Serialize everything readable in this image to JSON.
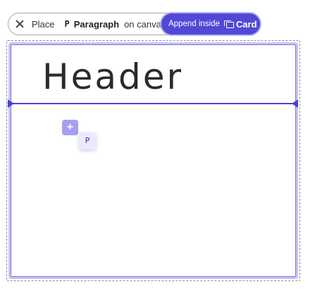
{
  "placement_bar": {
    "close_icon": "close-icon",
    "place_label": "Place",
    "element_glyph": "P",
    "element_name": "Paragraph",
    "on_canvas_label": "on canvas"
  },
  "append_target": {
    "prefix_label": "Append inside",
    "target_icon": "card-icon",
    "target_name": "Card",
    "accent_color": "#5148d8"
  },
  "canvas": {
    "header_text": "Header",
    "indicator_color": "#4b40d6"
  },
  "drag_ghost": {
    "plus_symbol": "+",
    "element_glyph": "P"
  }
}
